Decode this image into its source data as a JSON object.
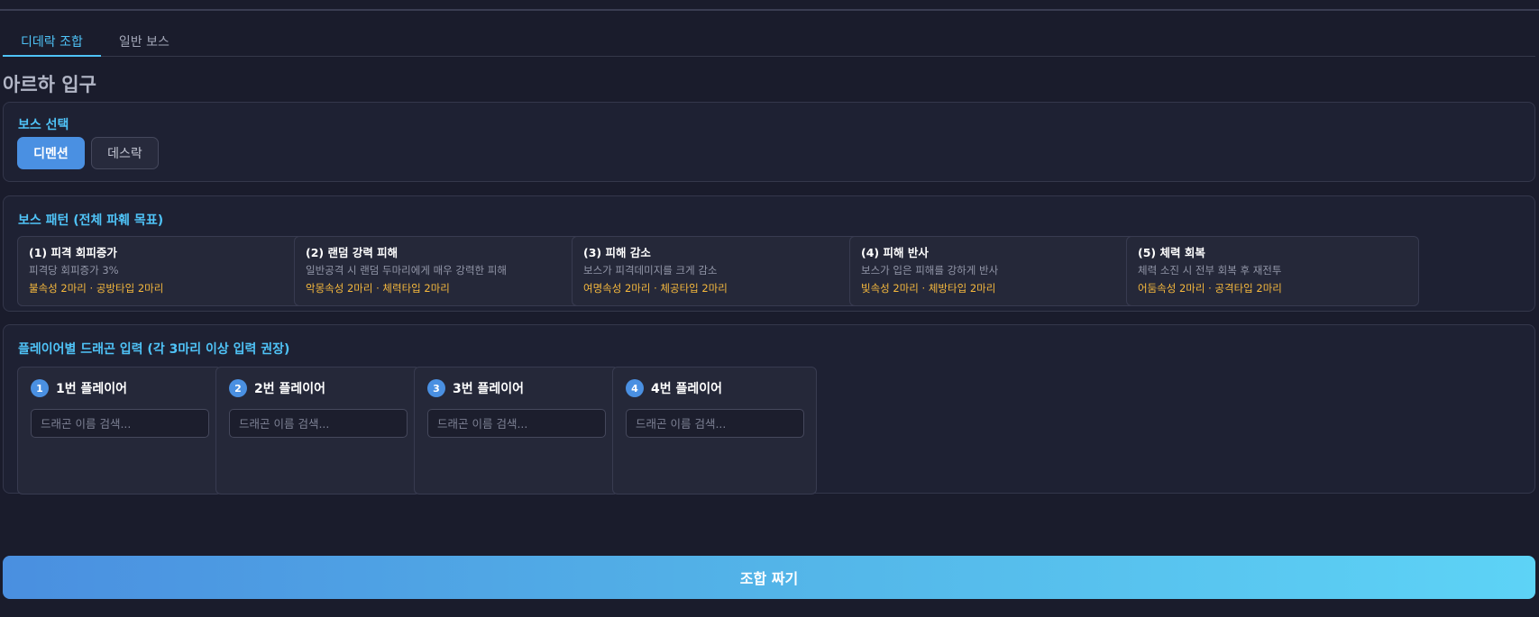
{
  "tabs": [
    {
      "label": "디데락 조합",
      "active": true
    },
    {
      "label": "일반 보스",
      "active": false
    }
  ],
  "page_title": "아르하 입구",
  "boss_select": {
    "title": "보스 선택",
    "options": [
      {
        "label": "디멘션",
        "selected": true
      },
      {
        "label": "데스락",
        "selected": false
      }
    ]
  },
  "boss_patterns": {
    "title": "보스 패턴 (전체 파훼 목표)",
    "items": [
      {
        "title": "(1) 피격 회피증가",
        "desc": "피격당 회피증가 3%",
        "req": "불속성 2마리 · 공방타입 2마리"
      },
      {
        "title": "(2) 랜덤 강력 피해",
        "desc": "일반공격 시 랜덤 두마리에게 매우 강력한 피해",
        "req": "악몽속성 2마리 · 체력타입 2마리"
      },
      {
        "title": "(3) 피해 감소",
        "desc": "보스가 피격데미지를 크게 감소",
        "req": "여명속성 2마리 · 체공타입 2마리"
      },
      {
        "title": "(4) 피해 반사",
        "desc": "보스가 입은 피해를 강하게 반사",
        "req": "빛속성 2마리 · 체방타입 2마리"
      },
      {
        "title": "(5) 체력 회복",
        "desc": "체력 소진 시 전부 회복 후 재전투",
        "req": "어둠속성 2마리 · 공격타입 2마리"
      }
    ]
  },
  "players": {
    "title": "플레이어별 드래곤 입력 (각 3마리 이상 입력 권장)",
    "items": [
      {
        "number": "1",
        "name": "1번 플레이어",
        "placeholder": "드래곤 이름 검색..."
      },
      {
        "number": "2",
        "name": "2번 플레이어",
        "placeholder": "드래곤 이름 검색..."
      },
      {
        "number": "3",
        "name": "3번 플레이어",
        "placeholder": "드래곤 이름 검색..."
      },
      {
        "number": "4",
        "name": "4번 플레이어",
        "placeholder": "드래곤 이름 검색..."
      }
    ]
  },
  "combo_button": "조합 짜기",
  "colors": {
    "accent": "#4fc3f7",
    "primary": "#4a90e2",
    "requirement": "#f5b83d",
    "background": "#1a1c2c"
  }
}
